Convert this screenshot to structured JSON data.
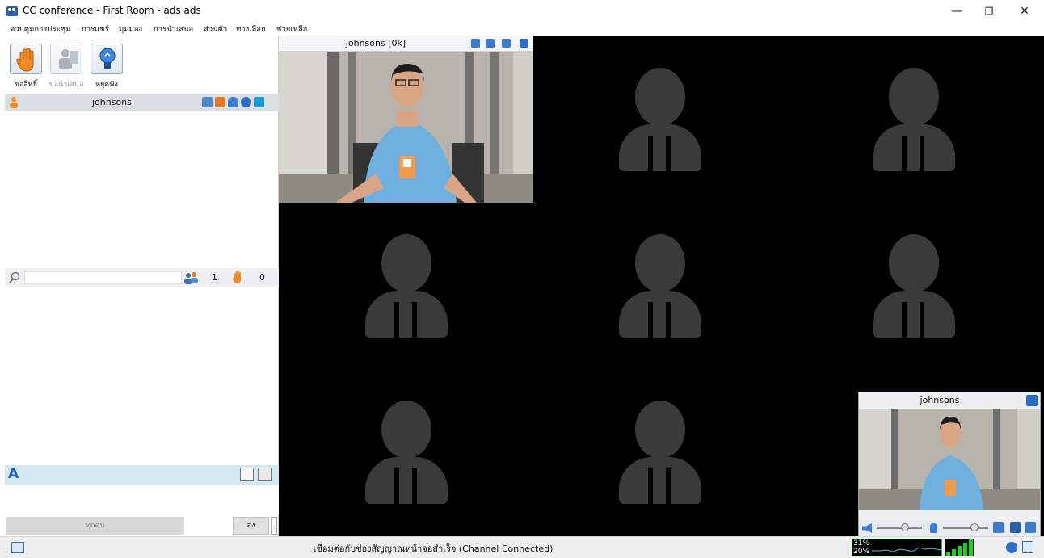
{
  "window": {
    "title": "CC conference - First Room - ads ads",
    "minimize": "—",
    "restore": "❐",
    "close": "✕"
  },
  "menu": [
    "ควบคุมการประชุม",
    "การแชร์",
    "มุมมอง",
    "การนำเสนอ",
    "ส่วนตัว",
    "ทางเลือก",
    "ช่วยเหลือ"
  ],
  "toolbar": {
    "raise_hand": "ขอสิทธิ์",
    "request_present": "ขอนำเสนอ",
    "stop_listen": "หยุดฟัง"
  },
  "participants": {
    "selected_user": "johnsons",
    "search_placeholder": "",
    "user_count": "1",
    "hand_count": "0"
  },
  "chat": {
    "to": "ทุกคน",
    "send": "ส่ง",
    "more": "."
  },
  "video": {
    "main_feed_name": "johnsons [0k]",
    "self_view_name": "johnsons",
    "placeholder_slots": 8
  },
  "status": {
    "message": "เชื่อมต่อกับช่องสัญญาณหน้าจอสำเร็จ (Channel Connected)",
    "cpu_top": "31%",
    "cpu_bottom": "20%",
    "signal_level": 5
  },
  "colors": {
    "accent": "#3a7bd5",
    "signal": "#1fd21f"
  },
  "icons": [
    "hand-icon",
    "presenter-icon",
    "lightbulb-icon",
    "search-icon",
    "users-icon",
    "save-icon",
    "font-icon",
    "mic-icon",
    "camera-icon",
    "pin-icon",
    "close-icon",
    "speaker-icon",
    "settings-icon",
    "info-icon"
  ]
}
